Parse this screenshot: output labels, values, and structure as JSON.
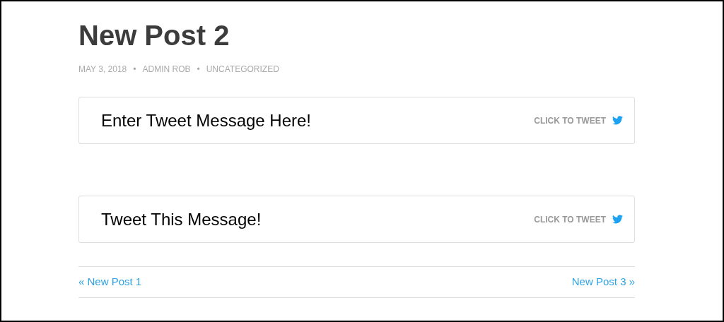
{
  "post": {
    "title": "New Post 2",
    "meta": [
      "MAY 3, 2018",
      "ADMIN ROB",
      "UNCATEGORIZED"
    ],
    "meta_separator": "•"
  },
  "tweet_boxes": [
    {
      "message": "Enter Tweet Message Here!",
      "action": "CLICK TO TWEET"
    },
    {
      "message": "Tweet This Message!",
      "action": "CLICK TO TWEET"
    }
  ],
  "post_navigation": {
    "previous": "« New Post 1",
    "next": "New Post 3 »"
  }
}
